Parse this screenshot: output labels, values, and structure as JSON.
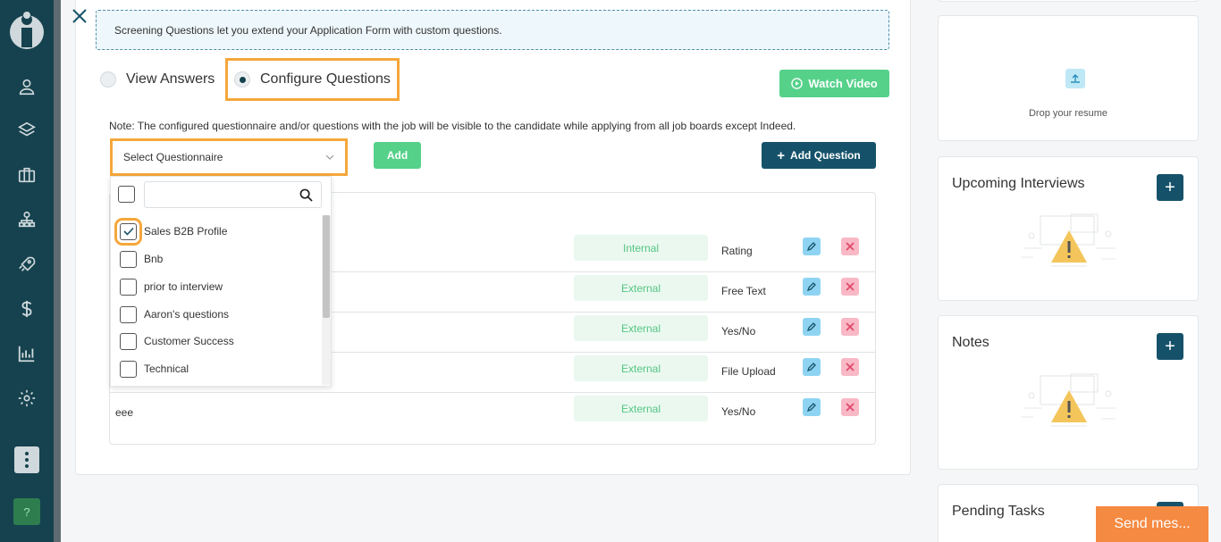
{
  "info_banner": "Screening Questions let you extend your Application Form with custom questions.",
  "radios": {
    "view_answers": "View Answers",
    "configure_questions": "Configure Questions"
  },
  "watch_video": "Watch Video",
  "note": "Note: The configured questionnaire and/or questions with the job will be visible to the candidate while applying from all job boards except Indeed.",
  "select": {
    "placeholder": "Select Questionnaire"
  },
  "add_button": "Add",
  "add_question_button": "Add Question",
  "dropdown": {
    "search_value": "",
    "items": [
      {
        "label": "Sales B2B Profile",
        "checked": true
      },
      {
        "label": "Bnb",
        "checked": false
      },
      {
        "label": "prior to interview",
        "checked": false
      },
      {
        "label": "Aaron's questions",
        "checked": false
      },
      {
        "label": "Customer Success",
        "checked": false
      },
      {
        "label": "Technical",
        "checked": false
      }
    ]
  },
  "questions": [
    {
      "name": "",
      "source": "Internal",
      "format": "Rating"
    },
    {
      "name": "",
      "source": "External",
      "format": "Free Text"
    },
    {
      "name": "",
      "source": "External",
      "format": "Yes/No"
    },
    {
      "name": "",
      "source": "External",
      "format": "File Upload"
    },
    {
      "name": "eee",
      "source": "External",
      "format": "Yes/No"
    }
  ],
  "resume": {
    "drop_text": "Drop your resume"
  },
  "upcoming_interviews": {
    "title": "Upcoming Interviews"
  },
  "notes": {
    "title": "Notes"
  },
  "pending_tasks": {
    "title": "Pending Tasks"
  },
  "send_message": "Send mes...",
  "help_label": "?",
  "icons": {
    "nav": [
      "user-icon",
      "layers-icon",
      "briefcase-icon",
      "org-chart-icon",
      "rocket-icon",
      "dollar-icon",
      "analytics-icon",
      "gear-icon"
    ]
  },
  "colors": {
    "nav_bg": "#15424e",
    "accent_green": "#55d18a",
    "primary": "#15526a",
    "highlight": "#f5a73b",
    "send_message": "#f58a42"
  }
}
